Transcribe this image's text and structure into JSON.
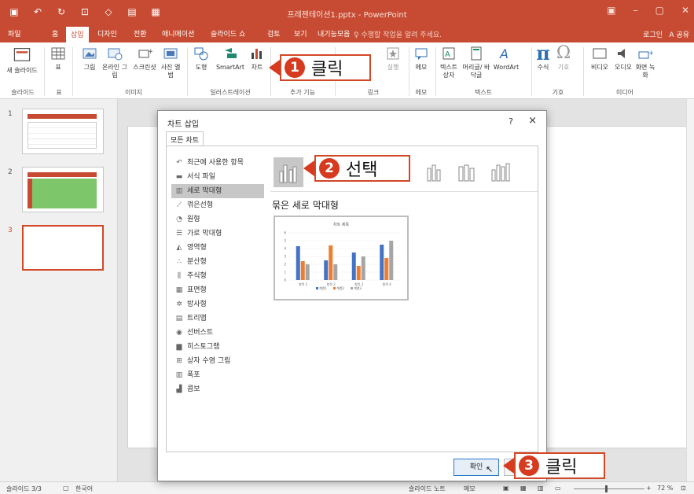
{
  "window": {
    "title": "프레젠테이션1.pptx - PowerPoint"
  },
  "tabs": [
    {
      "label": "파일"
    },
    {
      "label": "홈"
    },
    {
      "label": "삽입"
    },
    {
      "label": "디자인"
    },
    {
      "label": "전환"
    },
    {
      "label": "애니메이션"
    },
    {
      "label": "슬라이드 쇼"
    },
    {
      "label": "검토"
    },
    {
      "label": "보기"
    },
    {
      "label": "내기능모음"
    }
  ],
  "tellme": "♀ 수행할 작업을 알려 주세요.",
  "login": "로그인",
  "share": "A 공유",
  "ribbon": {
    "new_slide": "새 슬라이드",
    "table": "표",
    "picture": "그림",
    "online_picture": "온라인 그림",
    "screenshot": "스크린샷",
    "photo_album": "사진 앨범",
    "shapes": "도형",
    "smartart": "SmartArt",
    "chart": "차트",
    "addin": "추가 기능",
    "link": "링크",
    "action": "실행",
    "comment": "메모",
    "textbox": "텍스트 상자",
    "header": "머리글/ 바닥글",
    "wordart": "WordArt",
    "equation": "수식",
    "symbol": "기호",
    "video": "비디오",
    "audio": "오디오",
    "screen_rec": "화면 녹화",
    "groups": {
      "slides": "슬라이드",
      "tables": "표",
      "images": "이미지",
      "illustrations": "일러스트레이션",
      "addins": "추가 기능",
      "links": "링크",
      "comments": "메모",
      "text": "텍스트",
      "symbols": "기호",
      "media": "미디어"
    }
  },
  "thumbnails": [
    {
      "num": "1"
    },
    {
      "num": "2"
    },
    {
      "num": "3"
    }
  ],
  "dialog": {
    "title": "차트 삽입",
    "help": "?",
    "close": "×",
    "tab": "모든 차트",
    "categories": [
      {
        "label": "최근에 사용한 항목",
        "icon": "↶"
      },
      {
        "label": "서식 파일",
        "icon": "▬"
      },
      {
        "label": "세로 막대형",
        "icon": "▥"
      },
      {
        "label": "꺾은선형",
        "icon": "⟋"
      },
      {
        "label": "원형",
        "icon": "◔"
      },
      {
        "label": "가로 막대형",
        "icon": "☰"
      },
      {
        "label": "영역형",
        "icon": "◭"
      },
      {
        "label": "분산형",
        "icon": "∴"
      },
      {
        "label": "주식형",
        "icon": "⫼"
      },
      {
        "label": "표면형",
        "icon": "▦"
      },
      {
        "label": "방사형",
        "icon": "✲"
      },
      {
        "label": "트리맵",
        "icon": "▤"
      },
      {
        "label": "선버스트",
        "icon": "◉"
      },
      {
        "label": "히스토그램",
        "icon": "▆"
      },
      {
        "label": "상자 수염 그림",
        "icon": "⊞"
      },
      {
        "label": "폭포",
        "icon": "▥"
      },
      {
        "label": "콤보",
        "icon": "▟"
      }
    ],
    "subtype_title": "묶은 세로 막대형",
    "ok": "확인"
  },
  "preview_chart": {
    "title": "차트 제목",
    "categories": [
      "항목 1",
      "항목 2",
      "항목 3",
      "항목 4"
    ],
    "yticks": [
      "0",
      "1",
      "2",
      "3",
      "4",
      "5",
      "6"
    ],
    "series": [
      {
        "name": "계열1",
        "color": "#4472c4",
        "values": [
          4.3,
          2.5,
          3.5,
          4.5
        ]
      },
      {
        "name": "계열2",
        "color": "#ed7d31",
        "values": [
          2.4,
          4.4,
          1.8,
          2.8
        ]
      },
      {
        "name": "계열3",
        "color": "#a5a5a5",
        "values": [
          2,
          2,
          3,
          5
        ]
      }
    ]
  },
  "callouts": [
    {
      "num": "1",
      "text": "클릭"
    },
    {
      "num": "2",
      "text": "선택"
    },
    {
      "num": "3",
      "text": "클릭"
    }
  ],
  "status": {
    "slide": "슬라이드 3/3",
    "lang": "한국어",
    "notes": "슬라이드 노트",
    "comments": "메모",
    "zoom": "72 %"
  },
  "colors": {
    "accent": "#c64b32",
    "callout": "#d63a1f"
  }
}
